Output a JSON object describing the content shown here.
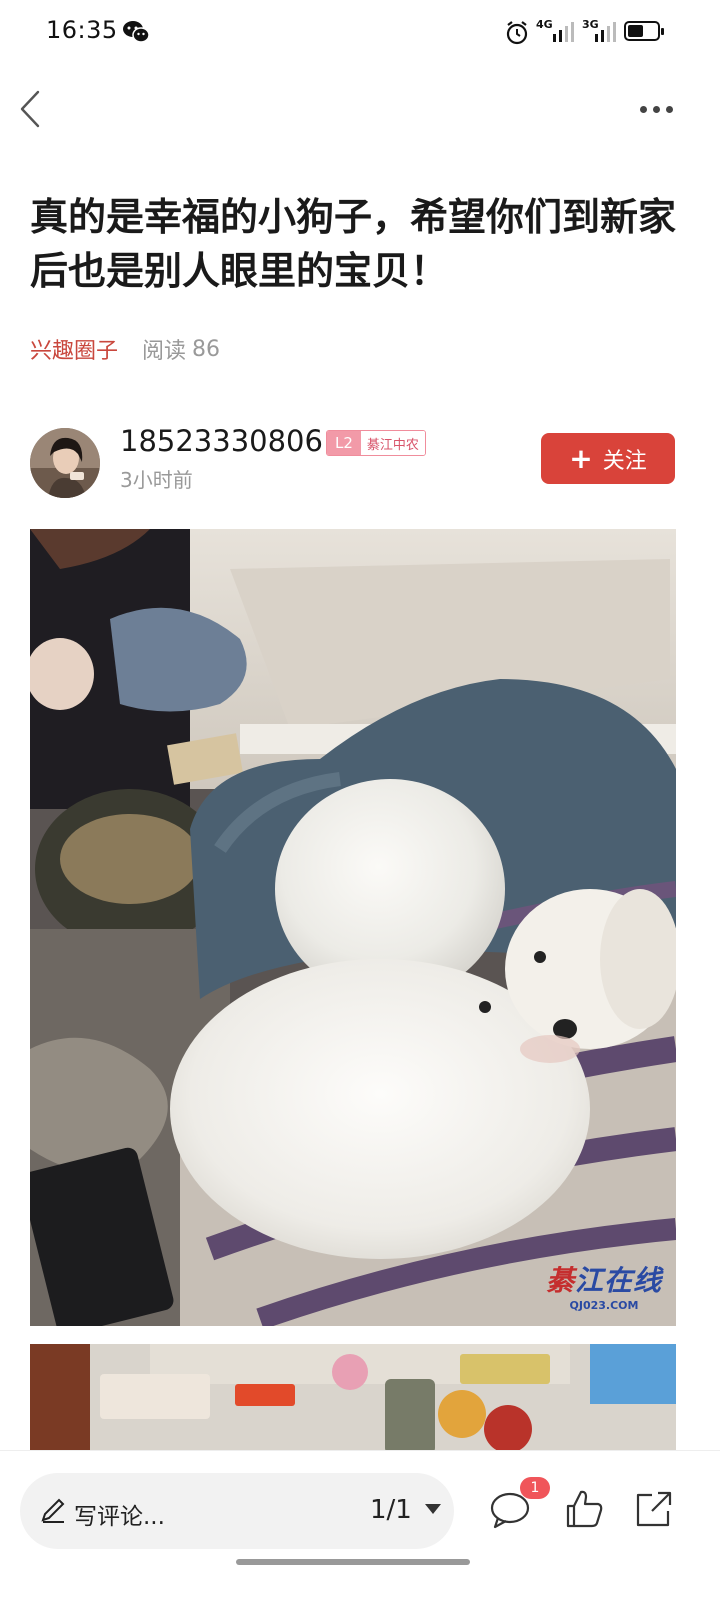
{
  "status_bar": {
    "time": "16:35",
    "notification_icon": "wechat-icon",
    "network_primary": "4G",
    "network_secondary": "3G",
    "battery_level": 0.55
  },
  "nav": {
    "back_icon": "chevron-left-icon",
    "more_icon": "more-dots-icon"
  },
  "post": {
    "title": "真的是幸福的小狗子，希望你们到新家后也是别人眼里的宝贝！",
    "category": "兴趣圈子",
    "read_label": "阅读",
    "read_count": "86"
  },
  "author": {
    "name": "18523330806",
    "level": "L2",
    "level_group": "綦江中农",
    "posted_ago": "3小时前",
    "follow_label": "关注"
  },
  "photos": {
    "watermark_main_red": "綦",
    "watermark_main_blue": "江在线",
    "watermark_sub": "QJ023.COM"
  },
  "bottom_bar": {
    "comment_placeholder": "写评论...",
    "page_indicator": "1/1",
    "comment_count": "1"
  },
  "colors": {
    "accent": "#d9433a",
    "category": "#c9473d",
    "badge": "#f29aa8"
  }
}
